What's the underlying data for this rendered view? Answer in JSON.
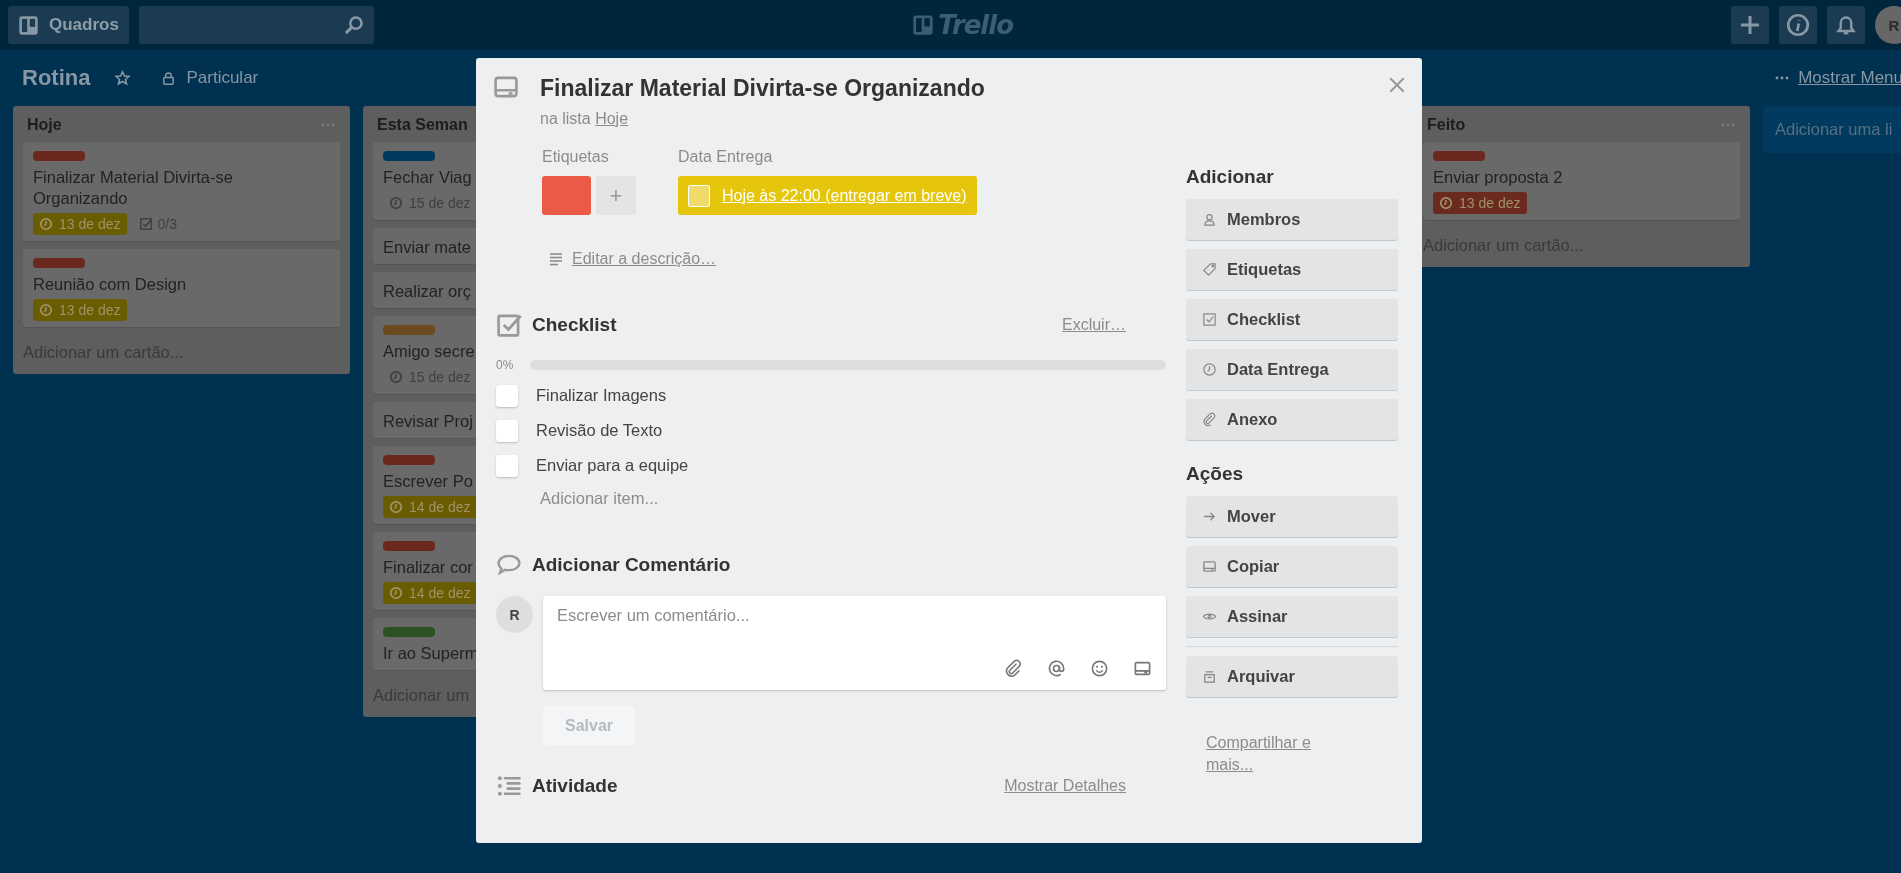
{
  "topbar": {
    "boards_button": "Quadros",
    "logo": "Trello",
    "avatar": "R"
  },
  "board": {
    "title": "Rotina",
    "visibility": "Particular",
    "menu_link": "Mostrar Menu"
  },
  "lists": [
    {
      "title": "Hoje",
      "cards": [
        {
          "color": "#6b281f",
          "title": "Finalizar Material Divirta-se Organizando",
          "due": {
            "text": "13 de dez",
            "color": "#6a5c00"
          },
          "checklist": "0/3"
        },
        {
          "color": "#6b281f",
          "title": "Reunião com Design",
          "due": {
            "text": "13 de dez",
            "color": "#6a5c00"
          }
        }
      ],
      "add_card": "Adicionar um cartão..."
    },
    {
      "title": "Esta Seman",
      "cards": [
        {
          "color": "#003a5c",
          "title": "Fechar Viag",
          "due": {
            "text": "15 de dez"
          }
        },
        {
          "title": "Enviar mate"
        },
        {
          "title": "Realizar orç"
        },
        {
          "color": "#6b4a1f",
          "title": "Amigo secre",
          "due": {
            "text": "15 de dez"
          }
        },
        {
          "title": "Revisar Proj"
        },
        {
          "color": "#6b281f",
          "title": "Escrever Po",
          "due": {
            "text": "14 de dez",
            "color": "#6a5c00"
          }
        },
        {
          "color": "#6b281f",
          "title": "Finalizar cor",
          "due": {
            "text": "14 de dez",
            "color": "#6a5c00"
          }
        },
        {
          "color": "#2d5222",
          "title": "Ir ao Superm"
        }
      ],
      "add_card": "Adicionar um"
    },
    {
      "title": "Feito",
      "cards": [
        {
          "color": "#6b281f",
          "title": "Enviar proposta 2",
          "due": {
            "text": "13 de dez",
            "color": "#6a2a20"
          }
        }
      ],
      "add_card": "Adicionar um cartão..."
    }
  ],
  "add_list": "Adicionar uma li",
  "modal": {
    "title": "Finalizar Material Divirta-se Organizando",
    "list_prefix": "na lista",
    "list_link": "Hoje",
    "labels_heading": "Etiquetas",
    "labels": [
      {
        "color": "#eb5a46"
      }
    ],
    "add_label": "+",
    "due_heading": "Data Entrega",
    "due": {
      "text": "Hoje às 22:00 (entregar em breve)",
      "done": false,
      "color": "#e6c60d"
    },
    "description_link": "Editar a descrição…",
    "checklist": {
      "title": "Checklist",
      "delete": "Excluir…",
      "percent": "0%",
      "level": 0,
      "items": [
        {
          "text": "Finalizar Imagens",
          "checked": false
        },
        {
          "text": "Revisão de Texto",
          "checked": false
        },
        {
          "text": "Enviar para a equipe",
          "checked": false
        }
      ],
      "add_item": "Adicionar item..."
    },
    "comment": {
      "title": "Adicionar Comentário",
      "avatar": "R",
      "placeholder": "Escrever um comentário...",
      "save": "Salvar",
      "save_disabled": true
    },
    "activity": {
      "title": "Atividade",
      "details_link": "Mostrar Detalhes"
    },
    "sidebar": {
      "add_heading": "Adicionar",
      "add_buttons": [
        {
          "kind": "members",
          "label": "Membros"
        },
        {
          "kind": "labels",
          "label": "Etiquetas"
        },
        {
          "kind": "checklist",
          "label": "Checklist"
        },
        {
          "kind": "due",
          "label": "Data Entrega"
        },
        {
          "kind": "attachment",
          "label": "Anexo"
        }
      ],
      "actions_heading": "Ações",
      "action_groups": [
        {
          "buttons": [
            {
              "kind": "move",
              "label": "Mover"
            },
            {
              "kind": "copy",
              "label": "Copiar"
            },
            {
              "kind": "subscribe",
              "label": "Assinar"
            }
          ]
        },
        {
          "buttons": [
            {
              "kind": "archive",
              "label": "Arquivar"
            }
          ]
        }
      ],
      "share_link": "Compartilhar e mais..."
    }
  }
}
